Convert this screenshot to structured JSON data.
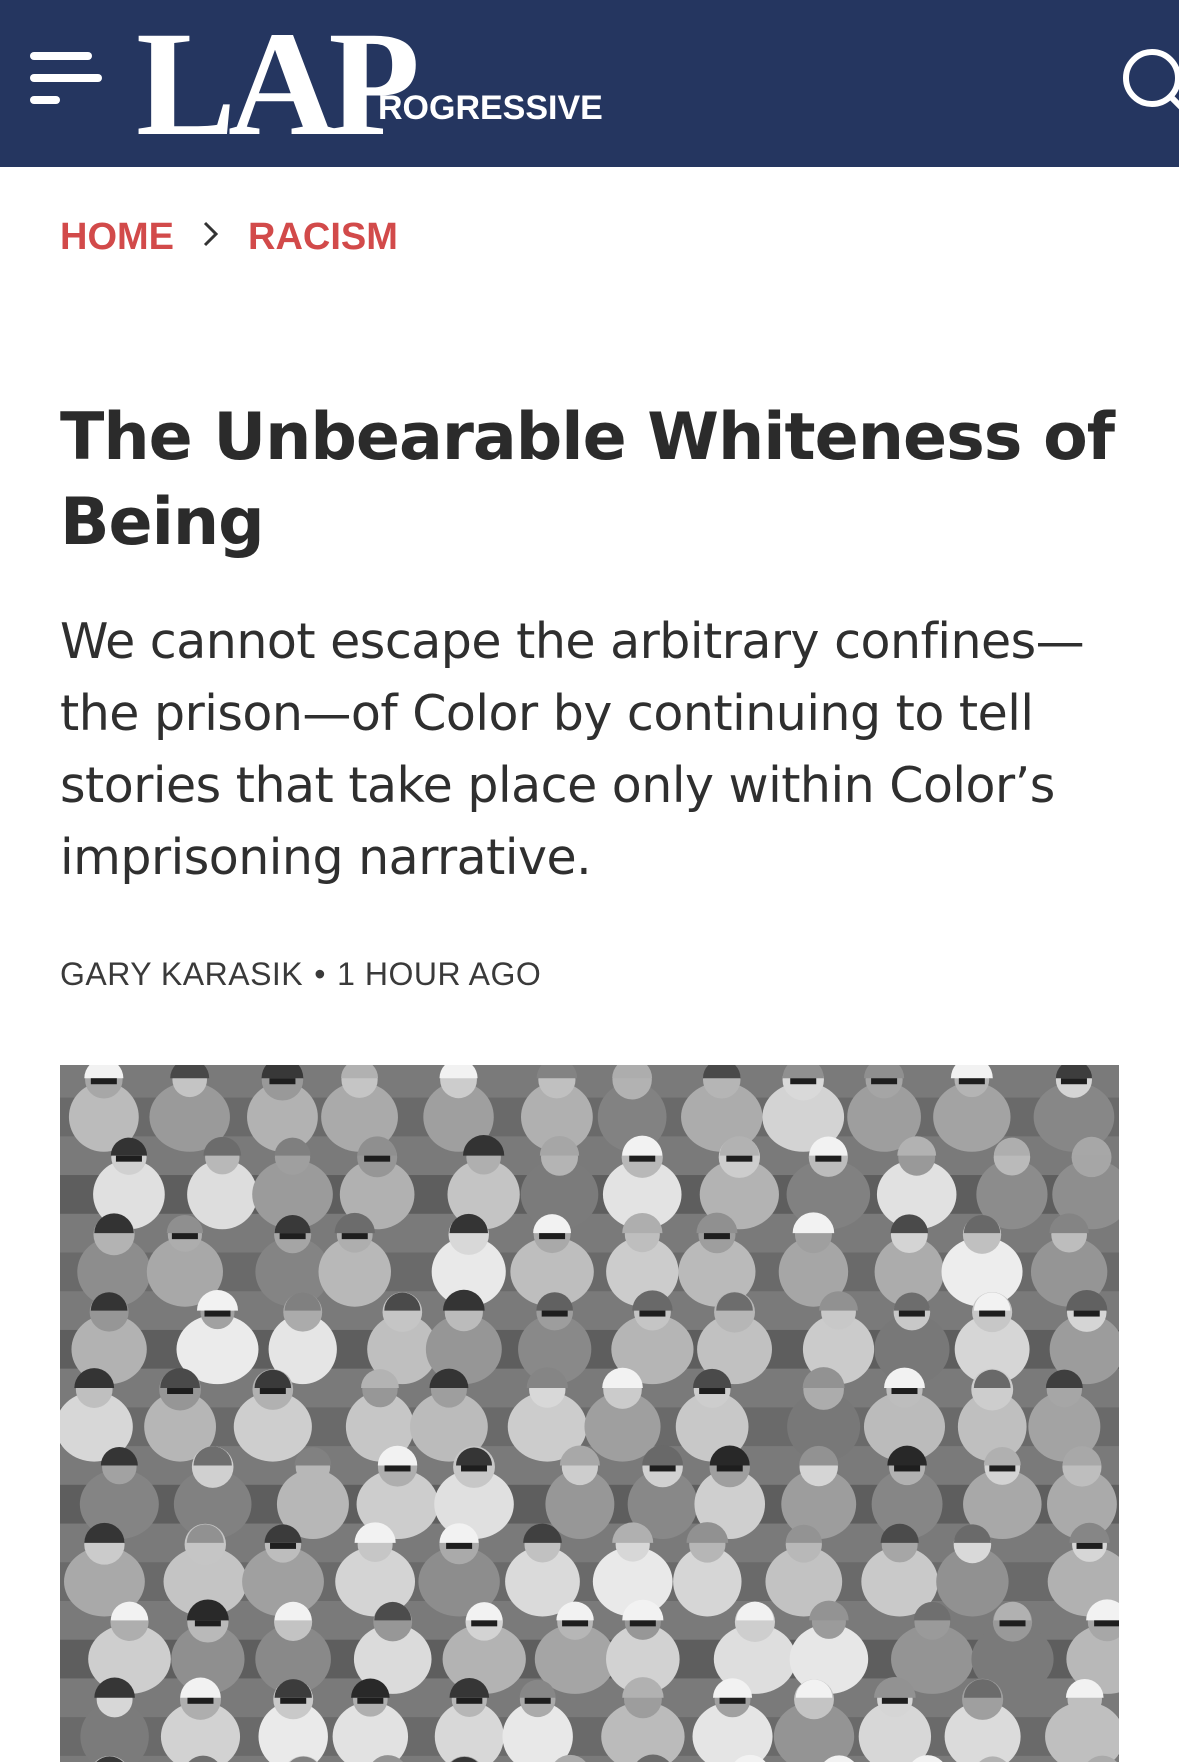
{
  "header": {
    "logo_main": "LAP",
    "logo_sub": "ROGRESSIVE",
    "menu_icon": "hamburger-menu-icon",
    "search_icon": "search-icon",
    "colors": {
      "background": "#253660",
      "foreground": "#ffffff"
    }
  },
  "breadcrumb": {
    "items": [
      {
        "label": "HOME"
      },
      {
        "label": "RACISM"
      }
    ],
    "separator": "›",
    "color": "#d24a4a"
  },
  "article": {
    "title": "The Unbearable Whiteness of Being",
    "subtitle": "We cannot escape the arbitrary confines—the prison—of Color by continuing to tell stories that take place only within Color’s imprisoning narrative.",
    "author": "GARY KARASIK",
    "separator": "•",
    "time": "1 HOUR AGO",
    "hero_image": "black-and-white-crowd-photo"
  }
}
